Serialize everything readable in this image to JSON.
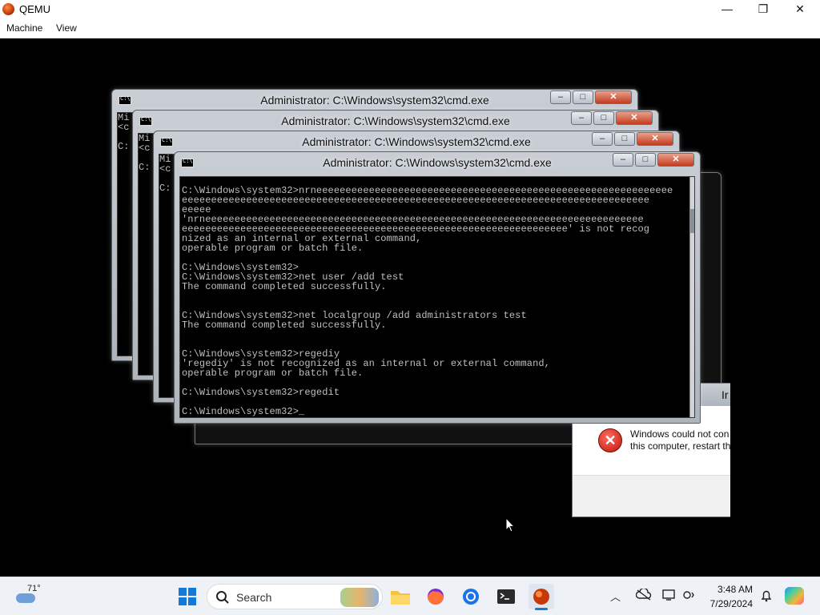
{
  "host": {
    "title": "QEMU",
    "menu": [
      "Machine",
      "View"
    ],
    "minimize": "—",
    "restore": "❐",
    "close": "✕"
  },
  "cmd_windows": [
    {
      "title": "Administrator: C:\\Windows\\system32\\cmd.exe",
      "peek": "Mi\n<c\n\nC:"
    },
    {
      "title": "Administrator: C:\\Windows\\system32\\cmd.exe",
      "peek": "Mi\n<c\n\nC:"
    },
    {
      "title": "Administrator: C:\\Windows\\system32\\cmd.exe",
      "peek": "Mi\n<c\n\nC:"
    },
    {
      "title": "Administrator: C:\\Windows\\system32\\cmd.exe"
    }
  ],
  "console_lines": [
    "C:\\Windows\\system32>nrneeeeeeeeeeeeeeeeeeeeeeeeeeeeeeeeeeeeeeeeeeeeeeeeeeeeeeeeeeeee",
    "eeeeeeeeeeeeeeeeeeeeeeeeeeeeeeeeeeeeeeeeeeeeeeeeeeeeeeeeeeeeeeeeeeeeeeeeeeeeeeee",
    "eeeee",
    "'nrneeeeeeeeeeeeeeeeeeeeeeeeeeeeeeeeeeeeeeeeeeeeeeeeeeeeeeeeeeeeeeeeeeeeeeeeeee",
    "eeeeeeeeeeeeeeeeeeeeeeeeeeeeeeeeeeeeeeeeeeeeeeeeeeeeeeeeeeeeeeeeee' is not recog",
    "nized as an internal or external command,",
    "operable program or batch file.",
    "",
    "C:\\Windows\\system32>",
    "C:\\Windows\\system32>net user /add test",
    "The command completed successfully.",
    "",
    "",
    "C:\\Windows\\system32>net localgroup /add administrators test",
    "The command completed successfully.",
    "",
    "",
    "C:\\Windows\\system32>regediy",
    "'regediy' is not recognized as an internal or external command,",
    "operable program or batch file.",
    "",
    "C:\\Windows\\system32>regedit",
    "",
    "C:\\Windows\\system32>_"
  ],
  "error_dialog": {
    "title_fragment": "Ir",
    "message_line1": "Windows could not con",
    "message_line2": "this computer, restart th"
  },
  "taskbar": {
    "temperature": "71°",
    "search_placeholder": "Search",
    "time": "3:48 AM",
    "date": "7/29/2024"
  }
}
